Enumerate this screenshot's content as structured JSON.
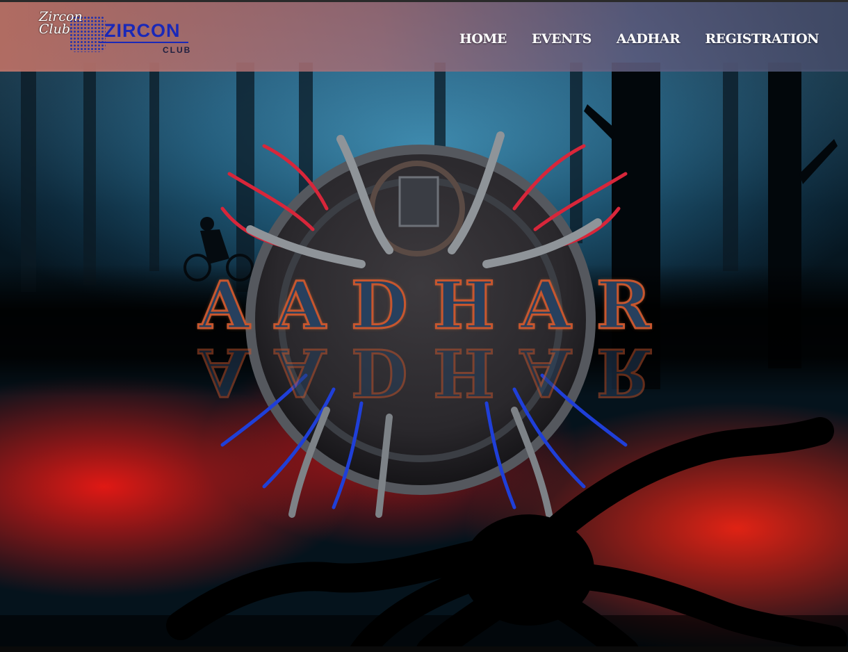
{
  "brand": {
    "script_text": "Zircon Club",
    "name": "ZIRCON",
    "sub": "CLUB"
  },
  "nav": {
    "items": [
      {
        "label": "HOME"
      },
      {
        "label": "EVENTS"
      },
      {
        "label": "AADHAR"
      },
      {
        "label": "REGISTRATION"
      }
    ]
  },
  "hero": {
    "letters": [
      "A",
      "A",
      "D",
      "H",
      "A",
      "R"
    ]
  },
  "colors": {
    "nav_gradient_start": "#c8786c",
    "nav_gradient_end": "#46506e",
    "logo_blue": "#1a28b8",
    "sky_blue": "#3f8fb3",
    "ground_red": "#eb1914"
  }
}
